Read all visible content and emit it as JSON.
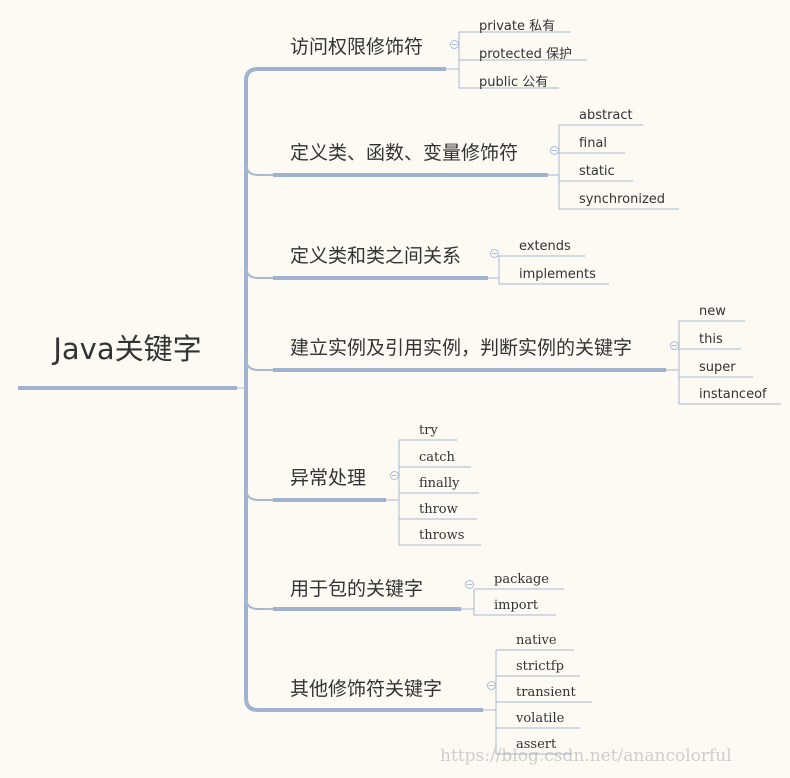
{
  "root": {
    "label": "Java关键字"
  },
  "colors": {
    "line": "#9fb3cf",
    "thin_line": "#a8b8d0",
    "background": "#fdfaf4",
    "text": "#333333"
  },
  "branches": [
    {
      "label": "访问权限修饰符",
      "children": [
        "private 私有",
        "protected 保护",
        "public 公有"
      ]
    },
    {
      "label": "定义类、函数、变量修饰符",
      "children": [
        "abstract",
        "final",
        "static",
        "synchronized"
      ]
    },
    {
      "label": "定义类和类之间关系",
      "children": [
        "extends",
        "implements"
      ]
    },
    {
      "label": "建立实例及引用实例，判断实例的关键字",
      "children": [
        "new",
        "this",
        "super",
        "instanceof"
      ]
    },
    {
      "label": "异常处理",
      "children": [
        "try",
        "catch",
        "finally",
        "throw",
        "throws"
      ]
    },
    {
      "label": "用于包的关键字",
      "children": [
        "package",
        "import"
      ]
    },
    {
      "label": "其他修饰符关键字",
      "children": [
        "native",
        "strictfp",
        "transient",
        "volatile",
        "assert"
      ]
    }
  ],
  "watermark": "https://blog.csdn.net/anancolorful"
}
